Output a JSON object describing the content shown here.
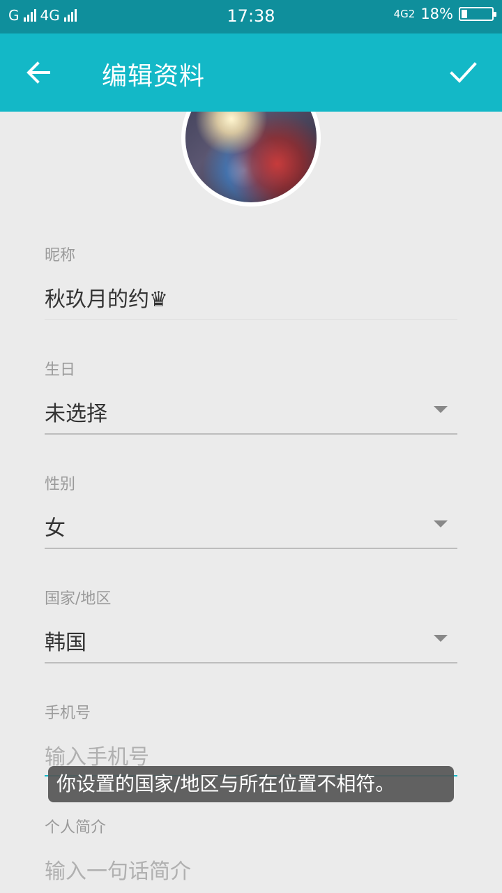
{
  "status_bar": {
    "carrier1": "G",
    "carrier2": "4G",
    "time": "17:38",
    "network_badge": "4G2",
    "battery_percent": "18%",
    "battery_level": 0.18
  },
  "app_bar": {
    "title": "编辑资料",
    "back_icon": "arrow-left-icon",
    "confirm_icon": "checkmark-icon",
    "color": "#13b8c7"
  },
  "form": {
    "nickname": {
      "label": "昵称",
      "value": "秋玖月的约♛"
    },
    "birthday": {
      "label": "生日",
      "value": "未选择"
    },
    "gender": {
      "label": "性别",
      "value": "女"
    },
    "region": {
      "label": "国家/地区",
      "value": "韩国"
    },
    "phone": {
      "label": "手机号",
      "placeholder": "输入手机号"
    },
    "bio": {
      "label": "个人简介",
      "placeholder": "输入一句话简介"
    }
  },
  "toast": {
    "message": "你设置的国家/地区与所在位置不相符。"
  }
}
